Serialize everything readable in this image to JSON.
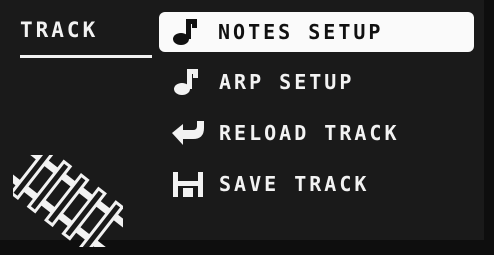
{
  "section": {
    "title": "TRACK"
  },
  "menu": {
    "items": [
      {
        "label": "NOTES SETUP",
        "icon": "music-note-icon",
        "selected": true
      },
      {
        "label": "ARP SETUP",
        "icon": "music-note-icon",
        "selected": false
      },
      {
        "label": "RELOAD TRACK",
        "icon": "reload-arrow-icon",
        "selected": false
      },
      {
        "label": "SAVE TRACK",
        "icon": "save-disk-icon",
        "selected": false
      }
    ]
  },
  "colors": {
    "background": "#1a1a1a",
    "foreground": "#f2f2f2",
    "highlight": "#fafafa"
  }
}
